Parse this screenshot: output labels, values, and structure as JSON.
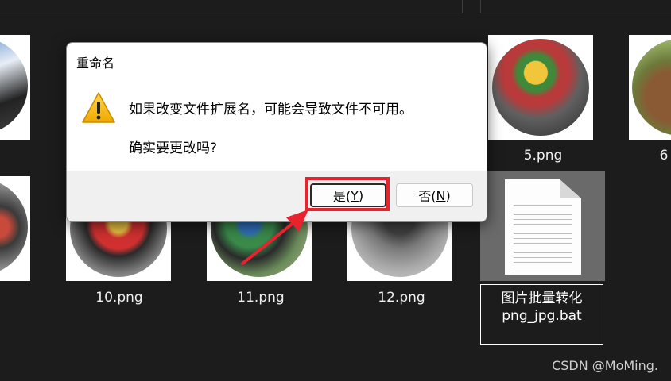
{
  "dialog": {
    "title": "重命名",
    "message_line1": "如果改变文件扩展名，可能会导致文件不可用。",
    "message_line2": "确实要更改吗?",
    "yes_prefix": "是(",
    "yes_key": "Y",
    "yes_suffix": ")",
    "no_prefix": "否(",
    "no_key": "N",
    "no_suffix": ")"
  },
  "files": {
    "item_5": "5.png",
    "item_6_partial": "6",
    "item_10": "10.png",
    "item_11": "11.png",
    "item_12": "12.png",
    "bat_line1": "图片批量转化",
    "bat_line2": "png_jpg.bat"
  },
  "watermark": "CSDN @MoMing.",
  "colors": {
    "background": "#1c1c1c",
    "highlight_red": "#e8232e",
    "selected_tile": "#6a6a6a"
  }
}
